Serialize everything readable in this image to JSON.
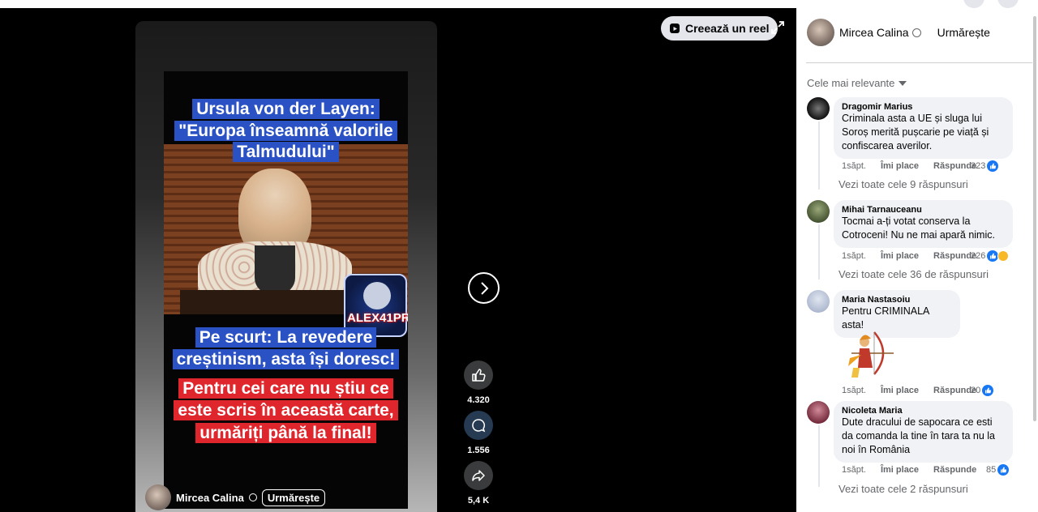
{
  "create_reel": {
    "label": "Creează un reel",
    "icon": "reel-icon"
  },
  "video": {
    "caption_top": [
      "Ursula von der Layen:",
      "\"Europa înseamnă valorile",
      "Talmudului\""
    ],
    "caption_blue": [
      "Pe scurt: La revedere",
      "creștinism, asta își doresc!"
    ],
    "caption_red": [
      "Pentru cei care nu știu ce",
      "este scris în această carte,",
      "urmăriți până la final!"
    ],
    "logo_text": "ALEX41PR",
    "owner_name": "Mircea Calina",
    "follow_label": "Urmărește"
  },
  "actions": {
    "likes": "4.320",
    "comments": "1.556",
    "shares": "5,4 K"
  },
  "panel": {
    "owner_name": "Mircea Calina",
    "follow_label": "Urmărește",
    "sort_label": "Cele mai relevante"
  },
  "comments": [
    {
      "name": "Dragomir Marius",
      "lines": [
        "Criminala asta a UE și sluga lui",
        "Soroș merită pușcarie pe viață și",
        "confiscarea averilor."
      ],
      "time": "1săpt.",
      "like": "Îmi place",
      "reply": "Răspunde",
      "count": "323",
      "replies": "Vezi toate cele 9 răspunsuri",
      "avatar_color": "#2a2a2a"
    },
    {
      "name": "Mihai Tarnauceanu",
      "lines": [
        "Tocmai a-ți votat conserva la",
        "Cotroceni! Nu ne mai apară nimic."
      ],
      "time": "1săpt.",
      "like": "Îmi place",
      "reply": "Răspunde",
      "count": "226",
      "replies": "Vezi toate cele 36 de răspunsuri",
      "avatar_color": "#5a6a40"
    },
    {
      "name": "Maria Nastasoiu",
      "lines": [
        "Pentru CRIMINALA asta!"
      ],
      "time": "1săpt.",
      "like": "Îmi place",
      "reply": "Răspunde",
      "count": "20",
      "avatar_color": "#b8c4d8"
    },
    {
      "name": "Nicoleta Maria",
      "lines": [
        "Dute dracului de sapocara ce esti",
        "da comanda la tine în tara ta nu la",
        "noi în România"
      ],
      "time": "1săpt.",
      "like": "Îmi place",
      "reply": "Răspunde",
      "count": "85",
      "replies": "Vezi toate cele 2 răspunsuri",
      "avatar_color": "#8a3a4a"
    }
  ]
}
